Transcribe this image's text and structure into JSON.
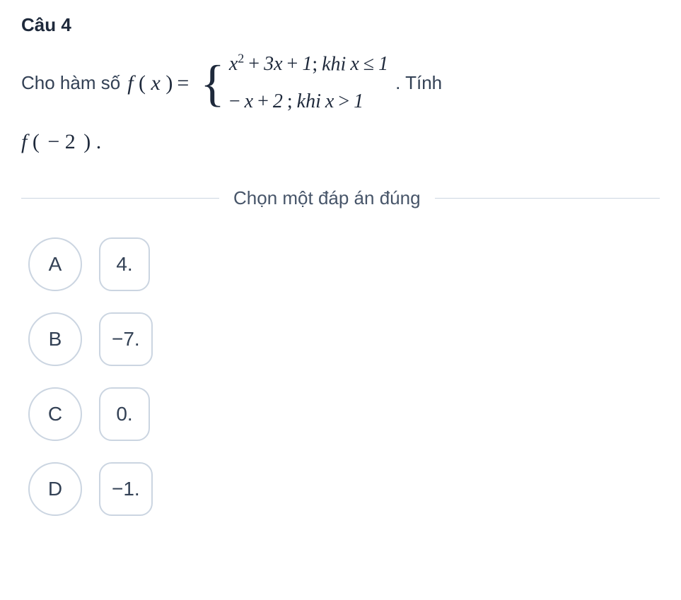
{
  "question": {
    "title": "Câu 4",
    "intro": "Cho hàm số",
    "function_name": "f",
    "variable": "x",
    "piecewise": {
      "piece1": {
        "expr_html": "x<span class='sup'>2</span><span class='space'></span><span class='normal'>+</span><span class='space'></span>3x<span class='space'></span><span class='normal'>+</span><span class='space'></span>1",
        "sep": ";",
        "cond_word": "khi",
        "cond_html": "x<span class='space'></span><span class='normal'>&le;</span><span class='space'></span>1"
      },
      "piece2": {
        "expr_html": "<span class='normal'>&minus;</span><span class='space'></span>x<span class='space'></span><span class='normal'>+</span><span class='space'></span>2",
        "sep": ";",
        "cond_word": "khi",
        "cond_html": "x<span class='space'></span><span class='normal'>&gt;</span><span class='space'></span>1"
      }
    },
    "suffix": ". Tính",
    "compute": {
      "func": "f",
      "arg": "− 2",
      "trail": "."
    }
  },
  "instruction": "Chọn một đáp án đúng",
  "options": [
    {
      "letter": "A",
      "value": "4."
    },
    {
      "letter": "B",
      "value": "−7."
    },
    {
      "letter": "C",
      "value": "0."
    },
    {
      "letter": "D",
      "value": "−1."
    }
  ]
}
